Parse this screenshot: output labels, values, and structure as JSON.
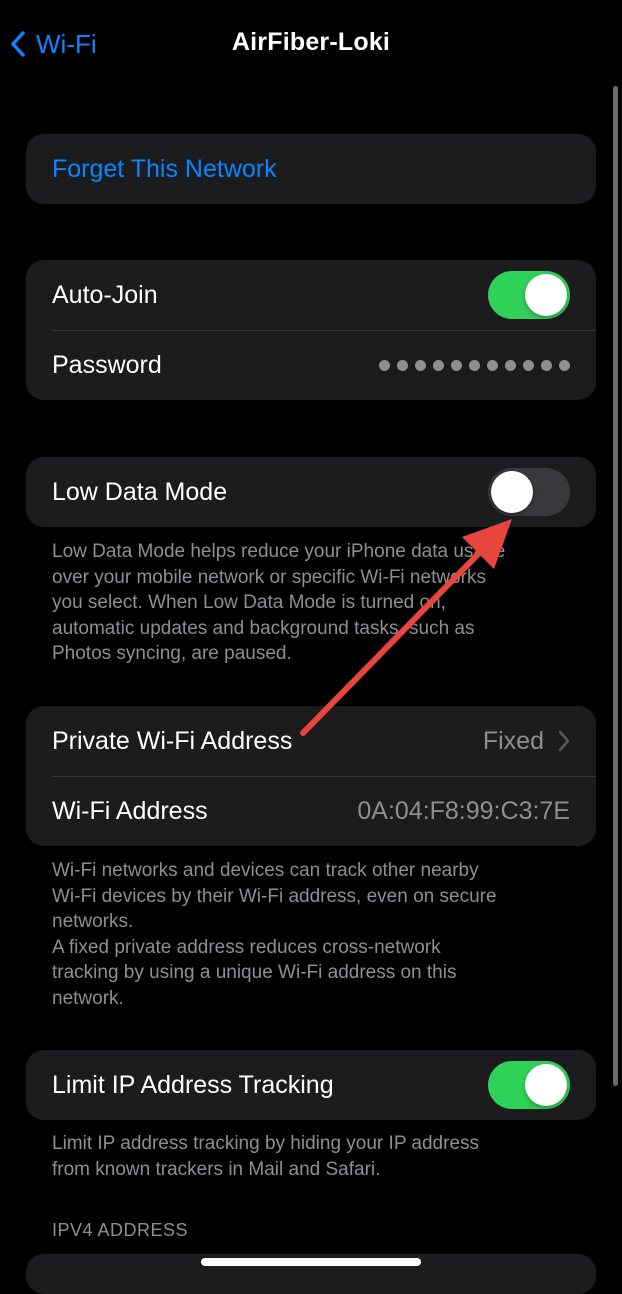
{
  "nav": {
    "back_label": "Wi-Fi",
    "title": "AirFiber-Loki"
  },
  "forget": {
    "label": "Forget This Network"
  },
  "auto_join": {
    "label": "Auto-Join",
    "enabled": true
  },
  "password": {
    "label": "Password",
    "masked_dots": 11
  },
  "low_data": {
    "label": "Low Data Mode",
    "enabled": false,
    "footnote": "Low Data Mode helps reduce your iPhone data usage\nover your mobile network or specific Wi-Fi networks\nyou select. When Low Data Mode is turned on,\nautomatic updates and background tasks, such as\nPhotos syncing, are paused."
  },
  "private_address": {
    "label": "Private Wi-Fi Address",
    "value": "Fixed"
  },
  "wifi_address": {
    "label": "Wi-Fi Address",
    "value": "0A:04:F8:99:C3:7E"
  },
  "address_footnote": "Wi-Fi networks and devices can track other nearby\nWi-Fi devices by their Wi-Fi address, even on secure\nnetworks.\nA fixed private address reduces cross-network\ntracking by using a unique Wi-Fi address on this\nnetwork.",
  "limit_ip": {
    "label": "Limit IP Address Tracking",
    "enabled": true,
    "footnote": "Limit IP address tracking by hiding your IP address\nfrom known trackers in Mail and Safari."
  },
  "ipv4": {
    "header": "IPV4 ADDRESS"
  },
  "colors": {
    "accent": "#0a84ff",
    "toggle_on": "#30d158",
    "annotation_arrow": "#e8453c"
  }
}
